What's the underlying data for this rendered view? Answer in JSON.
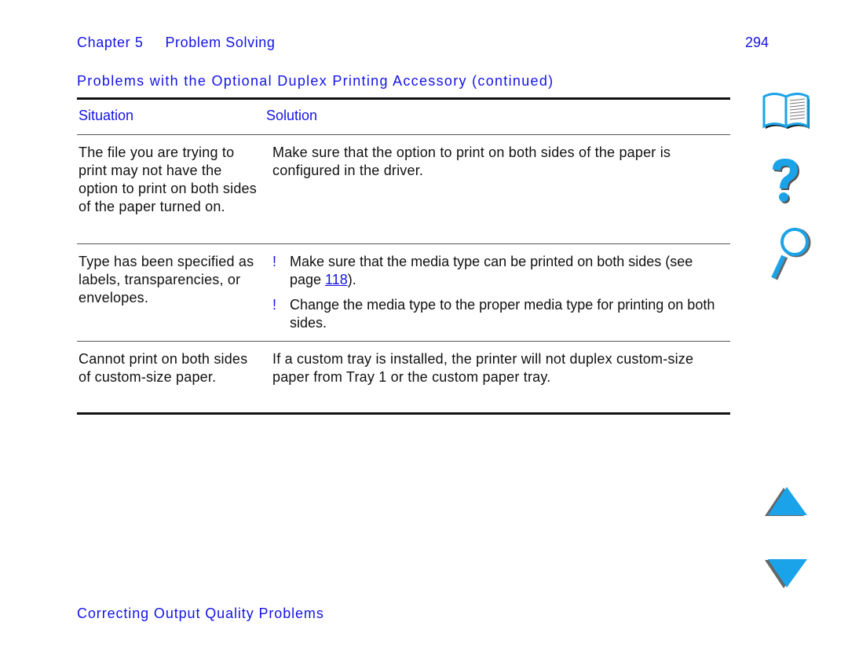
{
  "header": {
    "chapter": "Chapter 5",
    "chapter_title": "Problem Solving",
    "page_number": "294"
  },
  "section_title": "Problems with the Optional Duplex Printing Accessory (continued)",
  "table": {
    "columns": [
      "Situation",
      "Solution"
    ],
    "rows": [
      {
        "situation": "The file you are trying to print may not have the option to print on both sides of the paper turned on.",
        "solution": "Make sure that the option to print on both sides of the paper is configured in the driver."
      },
      {
        "situation": "Type has been specified as labels, transparencies, or envelopes.",
        "bullets": [
          {
            "marker": "!",
            "text_before": "Make sure that the media type can be printed on both sides (see page ",
            "link": "118",
            "text_after": ")."
          },
          {
            "marker": "!",
            "text": "Change the media type to the proper media type for printing on both sides."
          }
        ]
      },
      {
        "situation": "Cannot print on both sides of custom-size paper.",
        "solution": "If a custom tray is installed, the printer will not duplex custom-size paper from Tray 1 or the custom paper tray."
      }
    ]
  },
  "footer": "Correcting Output Quality Problems",
  "nav_icons": [
    "book-icon",
    "help-question-icon",
    "search-magnifier-icon",
    "previous-page-arrow-icon",
    "next-page-arrow-icon"
  ],
  "colors": {
    "heading_blue": "#1414e6",
    "icon_blue": "#1aa3e8"
  }
}
